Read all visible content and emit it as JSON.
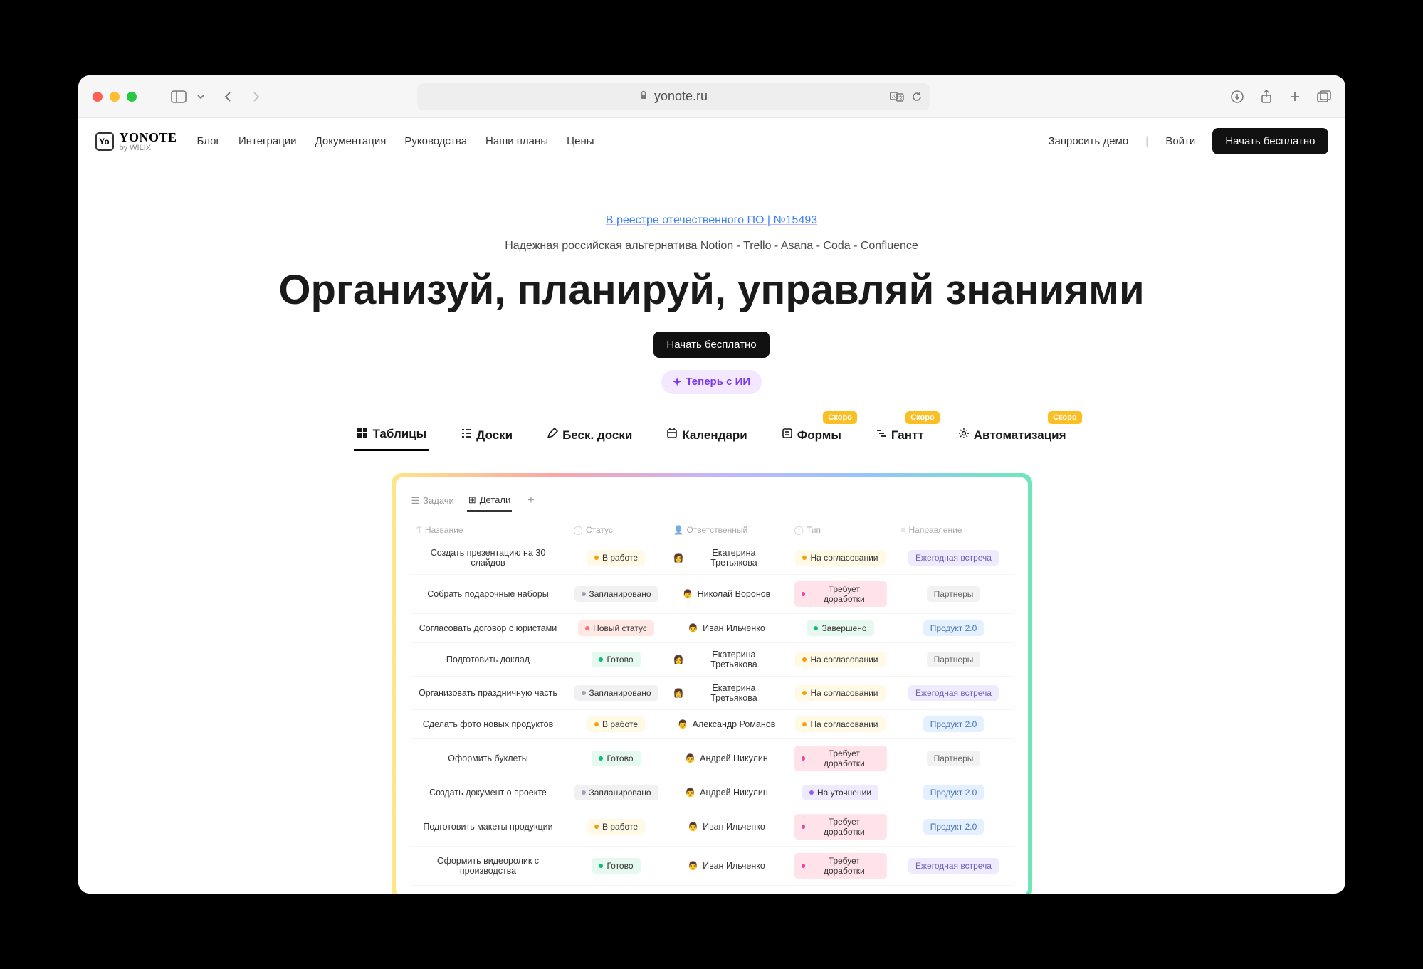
{
  "browser": {
    "url": "yonote.ru"
  },
  "header": {
    "logo_name": "YONOTE",
    "logo_sub": "by WILIX",
    "nav": [
      "Блог",
      "Интеграции",
      "Документация",
      "Руководства",
      "Наши планы",
      "Цены"
    ],
    "right_demo": "Запросить демо",
    "right_login": "Войти",
    "right_cta": "Начать бесплатно"
  },
  "hero": {
    "registry_link": "В реестре отечественного ПО | №15493",
    "subtitle": "Надежная российская альтернатива Notion - Trello - Asana - Coda - Confluence",
    "title": "Организуй, планируй, управляй знаниями",
    "cta": "Начать бесплатно",
    "ai_badge": "Теперь с ИИ"
  },
  "tabs": [
    {
      "label": "Таблицы",
      "active": true,
      "icon": "grid"
    },
    {
      "label": "Доски",
      "icon": "board"
    },
    {
      "label": "Беск. доски",
      "icon": "pen"
    },
    {
      "label": "Календари",
      "icon": "calendar"
    },
    {
      "label": "Формы",
      "icon": "form",
      "soon": "Скоро"
    },
    {
      "label": "Гантт",
      "icon": "gantt",
      "soon": "Скоро"
    },
    {
      "label": "Автоматизация",
      "icon": "automation",
      "soon": "Скоро"
    }
  ],
  "view_tabs": {
    "items": [
      "Задачи",
      "Детали"
    ],
    "active": "Детали"
  },
  "columns": [
    "Название",
    "Статус",
    "Ответственный",
    "Тип",
    "Направление"
  ],
  "status_colors": {
    "В работе": {
      "bg": "#fff9e6",
      "dot": "#f59e0b"
    },
    "Запланировано": {
      "bg": "#f1f1f1",
      "dot": "#9ca3af"
    },
    "Новый статус": {
      "bg": "#ffe7e4",
      "dot": "#f87171"
    },
    "Готово": {
      "bg": "#e6f9ef",
      "dot": "#10b981"
    }
  },
  "type_colors": {
    "На согласовании": {
      "bg": "#fff9e6",
      "dot": "#f59e0b"
    },
    "Требует доработки": {
      "bg": "#ffe2ea",
      "dot": "#ec4899"
    },
    "Завершено": {
      "bg": "#e6f9ef",
      "dot": "#10b981"
    },
    "На уточнении": {
      "bg": "#f0eaff",
      "dot": "#8b5cf6"
    }
  },
  "dir_colors": {
    "Ежегодная встреча": {
      "bg": "#f0eaff",
      "text": "#6d62b5"
    },
    "Партнеры": {
      "bg": "#f2f2f2",
      "text": "#666"
    },
    "Продукт 2.0": {
      "bg": "#e4f0ff",
      "text": "#4875b5"
    }
  },
  "rows": [
    {
      "name": "Создать презентацию на 30 слайдов",
      "status": "В работе",
      "person": "Екатерина Третьякова",
      "avatar": "👩",
      "type": "На согласовании",
      "dir": "Ежегодная встреча"
    },
    {
      "name": "Собрать подарочные наборы",
      "status": "Запланировано",
      "person": "Николай Воронов",
      "avatar": "👨",
      "type": "Требует доработки",
      "dir": "Партнеры"
    },
    {
      "name": "Согласовать договор с юристами",
      "status": "Новый статус",
      "person": "Иван Ильченко",
      "avatar": "👨",
      "type": "Завершено",
      "dir": "Продукт 2.0"
    },
    {
      "name": "Подготовить доклад",
      "status": "Готово",
      "person": "Екатерина Третьякова",
      "avatar": "👩",
      "type": "На согласовании",
      "dir": "Партнеры"
    },
    {
      "name": "Организовать праздничную часть",
      "status": "Запланировано",
      "person": "Екатерина Третьякова",
      "avatar": "👩",
      "type": "На согласовании",
      "dir": "Ежегодная встреча"
    },
    {
      "name": "Сделать фото новых продуктов",
      "status": "В работе",
      "person": "Александр Романов",
      "avatar": "👨",
      "type": "На согласовании",
      "dir": "Продукт 2.0"
    },
    {
      "name": "Оформить буклеты",
      "status": "Готово",
      "person": "Андрей Никулин",
      "avatar": "👨",
      "type": "Требует доработки",
      "dir": "Партнеры"
    },
    {
      "name": "Создать документ о проекте",
      "status": "Запланировано",
      "person": "Андрей Никулин",
      "avatar": "👨",
      "type": "На уточнении",
      "dir": "Продукт 2.0"
    },
    {
      "name": "Подготовить макеты продукции",
      "status": "В работе",
      "person": "Иван Ильченко",
      "avatar": "👨",
      "type": "Требует доработки",
      "dir": "Продукт 2.0"
    },
    {
      "name": "Оформить видеоролик с производства",
      "status": "Готово",
      "person": "Иван Ильченко",
      "avatar": "👨",
      "type": "Требует доработки",
      "dir": "Ежегодная встреча"
    }
  ]
}
